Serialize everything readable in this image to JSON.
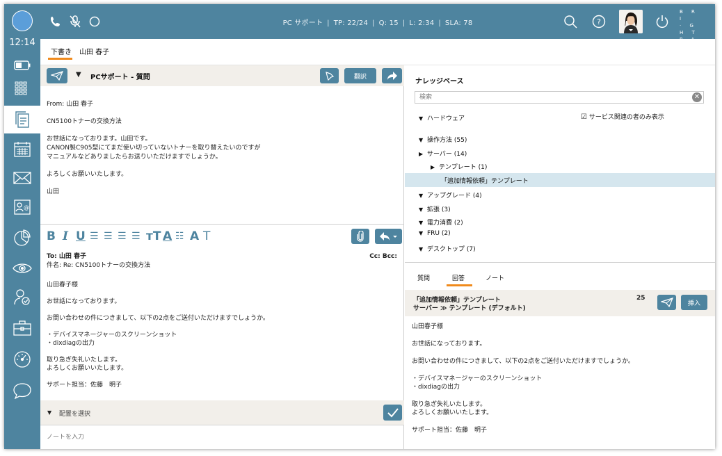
{
  "top_bar": {
    "status_title": "PC サポート",
    "tp": "TP: 22/24",
    "queue": "Q: 15",
    "length": "L: 2:34",
    "sla": "SLA: 78",
    "brand_lines": [
      "B R I",
      "· G H T",
      "P A T ·",
      "T E R N"
    ]
  },
  "left_nav": {
    "clock": "12:14"
  },
  "doc_tabs": {
    "draft": "下書き",
    "customer": "山田 春子"
  },
  "email": {
    "title": "PCサポート - 質問",
    "translate_label": "翻訳",
    "from": "From: 山田 春子",
    "subject": "CN5100トナーの交換方法",
    "body_line1": "お世話になっております。山田です。",
    "body_line2": "CANON製C905型にてまだ使い切っていないトナーを取り替えたいのですが",
    "body_line3": "マニュアルなどありましたらお送りいただけますでしょうか。",
    "closing": "よろしくお願いいたします。",
    "signature": "山田"
  },
  "composer": {
    "to": "To: 山田 春子",
    "cc_bcc": "Cc: Bcc:",
    "subject": "件名: Re: CN5100トナーの交換方法",
    "greeting": "山田春子様",
    "opening": "お世話になっております。",
    "request": "お問い合わせの件につきまして、以下の2点をご送付いただけますでしょうか。",
    "item1": "・デバイスマネージャーのスクリーンショット",
    "item2": "・dixdiagの出力",
    "closing1": "取り急ぎ失礼いたします。",
    "closing2": "よろしくお願いいたします。",
    "signature": "サポート担当：佐藤　明子",
    "disposition_placeholder": "配置を選択",
    "note_placeholder": "ノートを入力"
  },
  "knowledge_base": {
    "title": "ナレッジベース",
    "search_placeholder": "検索",
    "filter_label": "サービス関連の者のみ表示",
    "tree": {
      "hardware": "ハードウェア",
      "howto": "操作方法 (55)",
      "server": "サーバー (14)",
      "template": "テンプレート (1)",
      "selected_template": "「追加情報依頼」テンプレート",
      "upgrade": "アップグレード (4)",
      "expansion": "拡張 (3)",
      "power": "電力消費 (2)",
      "fru": "FRU (2)",
      "desktop": "デスクトップ (7)"
    },
    "tabs": {
      "question": "質問",
      "answer": "回答",
      "note": "ノート"
    },
    "article": {
      "title": "「追加情報依頼」テンプレート",
      "path": "サーバー ≫ テンプレート (デフォルト)",
      "count": "25",
      "insert_label": "挿入",
      "greeting": "山田春子様",
      "opening": "お世話になっております。",
      "request": "お問い合わせの件につきまして、以下の2点をご送付いただけますでしょうか。",
      "item1": "・デバイスマネージャーのスクリーンショット",
      "item2": "・dixdiagの出力",
      "closing1": "取り急ぎ失礼いたします。",
      "closing2": "よろしくお願いいたします。",
      "signature": "サポート担当：佐藤　明子"
    }
  },
  "colors": {
    "accent": "#4e849f",
    "highlight": "#f08a1c",
    "selected_row": "#d5e6ee",
    "header_bg": "#f2efea"
  }
}
